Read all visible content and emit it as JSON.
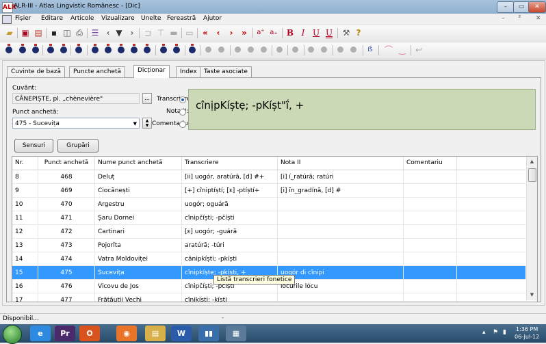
{
  "window": {
    "title": "ALR-III - Atlas Lingvistic Românesc - [Dic]",
    "app_icon": "ALR",
    "min": "–",
    "max": "▭",
    "close": "✕"
  },
  "menu": {
    "items": [
      "Fișier",
      "Editare",
      "Articole",
      "Vizualizare",
      "Unelte",
      "Fereastră",
      "Ajutor"
    ],
    "mdi_min": "–",
    "mdi_restore": "ᴱ",
    "mdi_close": "✕"
  },
  "toolbar1": {
    "icons": [
      "open-folder-icon",
      "red-book-icon",
      "page-icon",
      "save-icon",
      "print-preview-icon",
      "print-icon",
      "list-icon",
      "prev-icon",
      "bookmark-icon",
      "next-icon",
      "split-icon",
      "merge-icon",
      "join-icon",
      "rect-icon",
      "first-icon",
      "prev-red-icon",
      "next-red-icon",
      "last-icon",
      "superscript-a-icon",
      "subscript-a-icon",
      "bold-icon",
      "italic-icon",
      "underline-icon",
      "double-underline-icon",
      "tools-icon",
      "help-icon"
    ],
    "labels": {
      "bold": "B",
      "italic": "I",
      "underline": "U",
      "dunderline": "U",
      "sup": "a⁺",
      "sub": "a₊",
      "help": "?"
    }
  },
  "tabs": [
    "Cuvinte de bază",
    "Puncte anchetă",
    "Dicționar",
    "Index",
    "Taste asociate"
  ],
  "form": {
    "cuvant_label": "Cuvânt:",
    "cuvant_value": "CÂNEPIȘTE, pl. „chènevière\"",
    "ellipsis": "...",
    "punct_label": "Punct anchetă:",
    "punct_value": "475 - Sucevița",
    "transcriere_label": "Transcriere:",
    "nota_label": "Nota II:",
    "comentariu_label": "Comentariu:",
    "transcriere_text": "cînịpKíștẹ; -pKíșt\"ḯ, +",
    "sensuri_btn": "Sensuri",
    "grupari_btn": "Grupări"
  },
  "table": {
    "headers": [
      "Nr.",
      "Punct anchetă",
      "Nume punct anchetă",
      "Transcriere",
      "Nota II",
      "Comentariu"
    ],
    "rows": [
      {
        "nr": "8",
        "pa": "468",
        "np": "Deluț",
        "tr": "[ii] uogór, aratúră, [d] #+",
        "no": "[i] í_ratúră; ratúri",
        "co": ""
      },
      {
        "nr": "9",
        "pa": "469",
        "np": "Ciocănești",
        "tr": "[+] cîniptíștí; [ε] -ptíștí+",
        "no": "[i] ĩn_gradínă, [d] #",
        "co": ""
      },
      {
        "nr": "10",
        "pa": "470",
        "np": "Argestru",
        "tr": "uogór; oguáră",
        "no": "",
        "co": ""
      },
      {
        "nr": "11",
        "pa": "471",
        "np": "Șaru Dornei",
        "tr": "cînipčíști; -pčíști",
        "no": "",
        "co": ""
      },
      {
        "nr": "12",
        "pa": "472",
        "np": "Cartinari",
        "tr": "[ε] uogór; -guáră",
        "no": "",
        "co": ""
      },
      {
        "nr": "13",
        "pa": "473",
        "np": "Pojorîta",
        "tr": "aratúră; -túri",
        "no": "",
        "co": ""
      },
      {
        "nr": "14",
        "pa": "474",
        "np": "Vatra Moldoviței",
        "tr": "cânipkíști; -pkíști",
        "no": "",
        "co": ""
      },
      {
        "nr": "15",
        "pa": "475",
        "np": "Sucevița",
        "tr": "cînipkíște; -pkíști, +",
        "no": "uogór di cînipi",
        "co": ""
      },
      {
        "nr": "16",
        "pa": "476",
        "np": "Vicovu de Jos",
        "tr": "cînipčíști; -pčíști",
        "no": "locurile lócu",
        "co": ""
      },
      {
        "nr": "17",
        "pa": "477",
        "np": "Frătăuții Vechi",
        "tr": "cînikíști; -kíști",
        "no": "",
        "co": ""
      }
    ],
    "selected_index": 7,
    "tooltip": "Listă transcrieri fonetice"
  },
  "status": {
    "text": "Disponibil...",
    "mid": "-"
  },
  "taskbar": {
    "tasks": [
      "e",
      "Pr",
      "O",
      "◉",
      "▤",
      "W",
      "▮▮",
      "▦"
    ],
    "time": "1:36 PM",
    "date": "06-Jul-12"
  }
}
